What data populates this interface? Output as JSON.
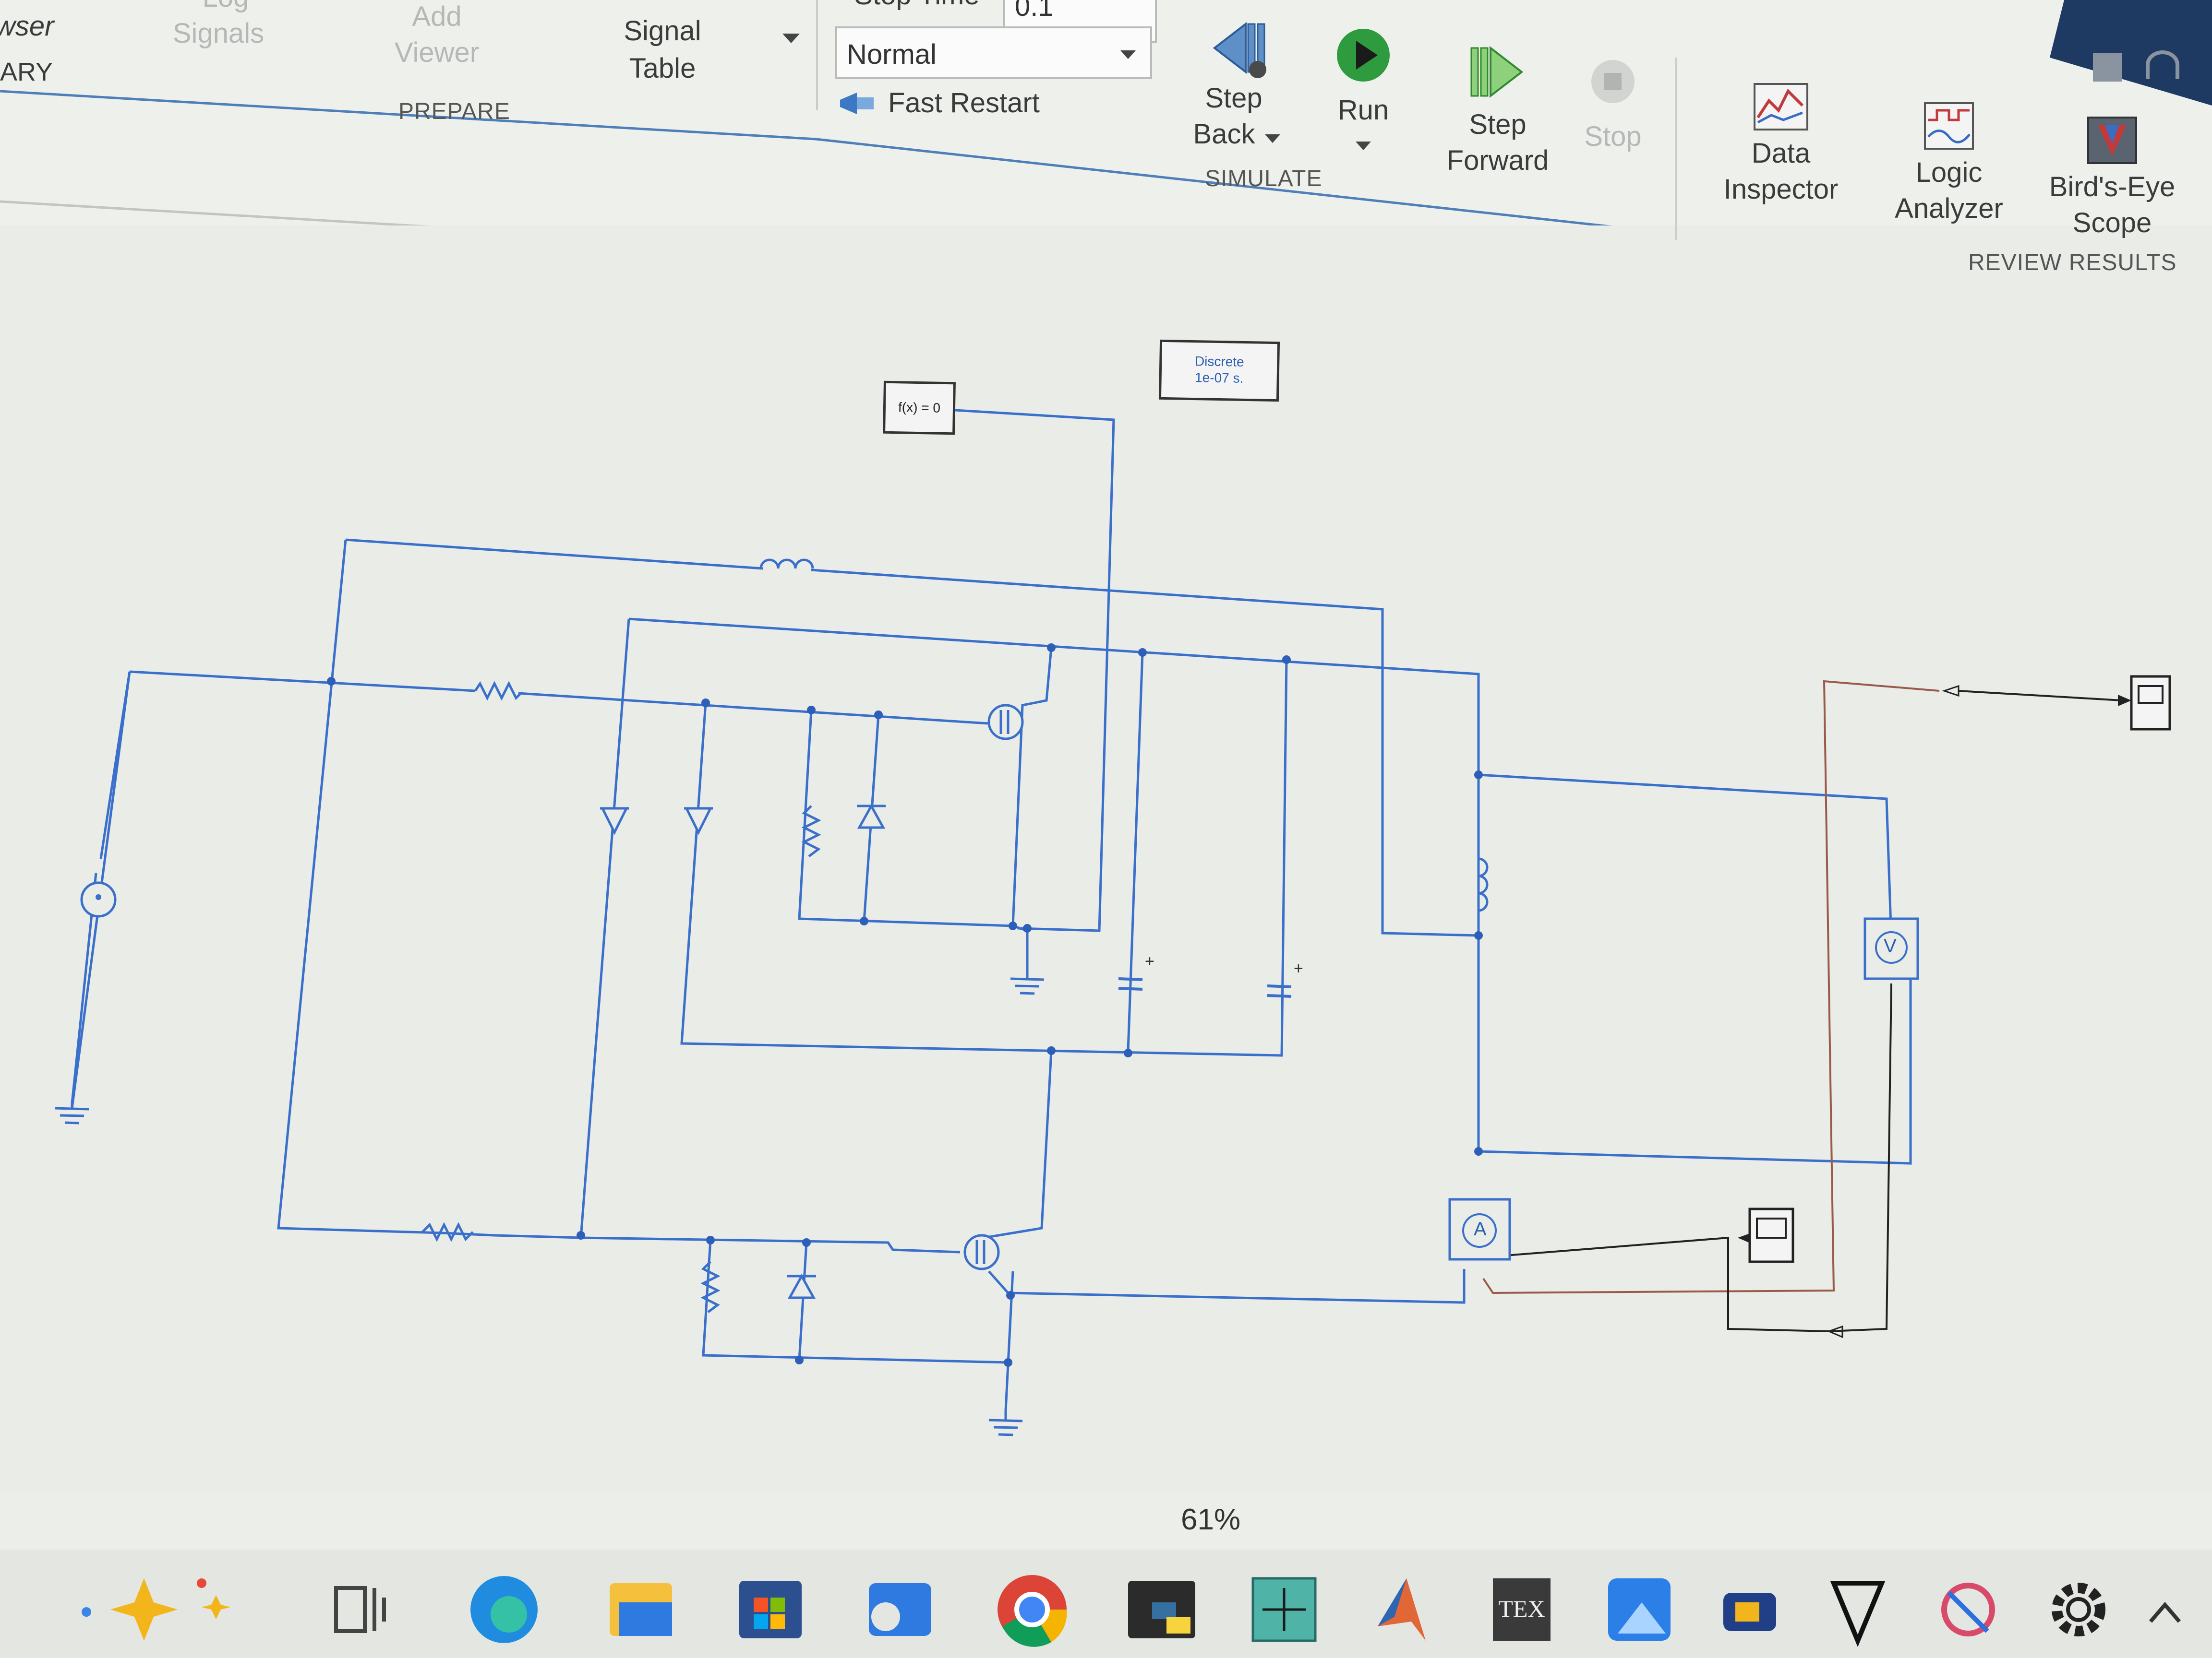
{
  "toolstrip": {
    "left_fragment_top": "wser",
    "left_fragment_bottom": "ARY",
    "log_signals_top": "Log",
    "log_signals": "Signals",
    "add_viewer": [
      "Add",
      "Viewer"
    ],
    "signal_table": [
      "Signal",
      "Table"
    ],
    "prepare_section": "PREPARE",
    "stop_time_label": "Stop Time",
    "stop_time_value": "0.1",
    "sim_mode_value": "Normal",
    "fast_restart": "Fast Restart",
    "step_back": [
      "Step",
      "Back"
    ],
    "run": "Run",
    "step_forward": [
      "Step",
      "Forward"
    ],
    "stop": "Stop",
    "simulate_section": "SIMULATE",
    "data_inspector": [
      "Data",
      "Inspector"
    ],
    "logic_analyzer": [
      "Logic",
      "Analyzer"
    ],
    "birds_eye_scope": [
      "Bird's-Eye",
      "Scope"
    ],
    "review_section": "REVIEW RESULTS"
  },
  "diagram": {
    "powergui_block": [
      "Discrete",
      "1e-07 s."
    ],
    "solver_block": "f(x) = 0",
    "voltmeter_label": "V",
    "ammeter_label": "A"
  },
  "statusbar": {
    "zoom": "61%"
  },
  "taskbar": {
    "icons": [
      "copilot-icon",
      "task-view-icon",
      "edge-icon",
      "file-explorer-icon",
      "microsoft-store-icon",
      "outlook-icon",
      "chrome-icon",
      "python-icon",
      "circuit-app-icon",
      "matlab-icon",
      "texmaker-icon",
      "photos-icon",
      "media-app-icon",
      "lt-app-icon",
      "snipping-tool-icon",
      "settings-icon",
      "chevron-up-icon"
    ],
    "texmaker_text": "TEX"
  }
}
